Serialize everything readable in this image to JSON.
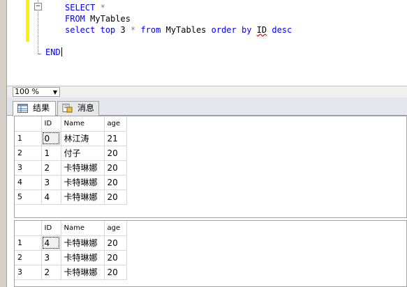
{
  "editor": {
    "lines": {
      "select_kw": "SELECT",
      "star": "*",
      "from_kw": "FROM",
      "from_table": "MyTables",
      "select2_kw": "select",
      "top_kw": "top",
      "top_n": "3",
      "star2": "*",
      "from2_kw": "from",
      "table2": "MyTables",
      "order_kw": "order",
      "by_kw": "by",
      "col": "ID",
      "desc_kw": "desc",
      "end_kw": "END"
    },
    "fold_symbol": "−"
  },
  "zoom": {
    "value": "100 %"
  },
  "tabs": {
    "results": "结果",
    "messages": "消息"
  },
  "results": [
    {
      "headers": [
        "",
        "ID",
        "Name",
        "age"
      ],
      "rows": [
        [
          "1",
          "0",
          "林江涛",
          "21"
        ],
        [
          "2",
          "1",
          "付子",
          "20"
        ],
        [
          "3",
          "2",
          "卡特琳娜",
          "20"
        ],
        [
          "4",
          "3",
          "卡特琳娜",
          "20"
        ],
        [
          "5",
          "4",
          "卡特琳娜",
          "20"
        ]
      ]
    },
    {
      "headers": [
        "",
        "ID",
        "Name",
        "age"
      ],
      "rows": [
        [
          "1",
          "4",
          "卡特琳娜",
          "20"
        ],
        [
          "2",
          "3",
          "卡特琳娜",
          "20"
        ],
        [
          "3",
          "2",
          "卡特琳娜",
          "20"
        ]
      ]
    }
  ],
  "icons": {
    "results_tab": "grid-icon",
    "messages_tab": "messages-icon",
    "zoom_dropdown": "chevron-down-icon"
  }
}
